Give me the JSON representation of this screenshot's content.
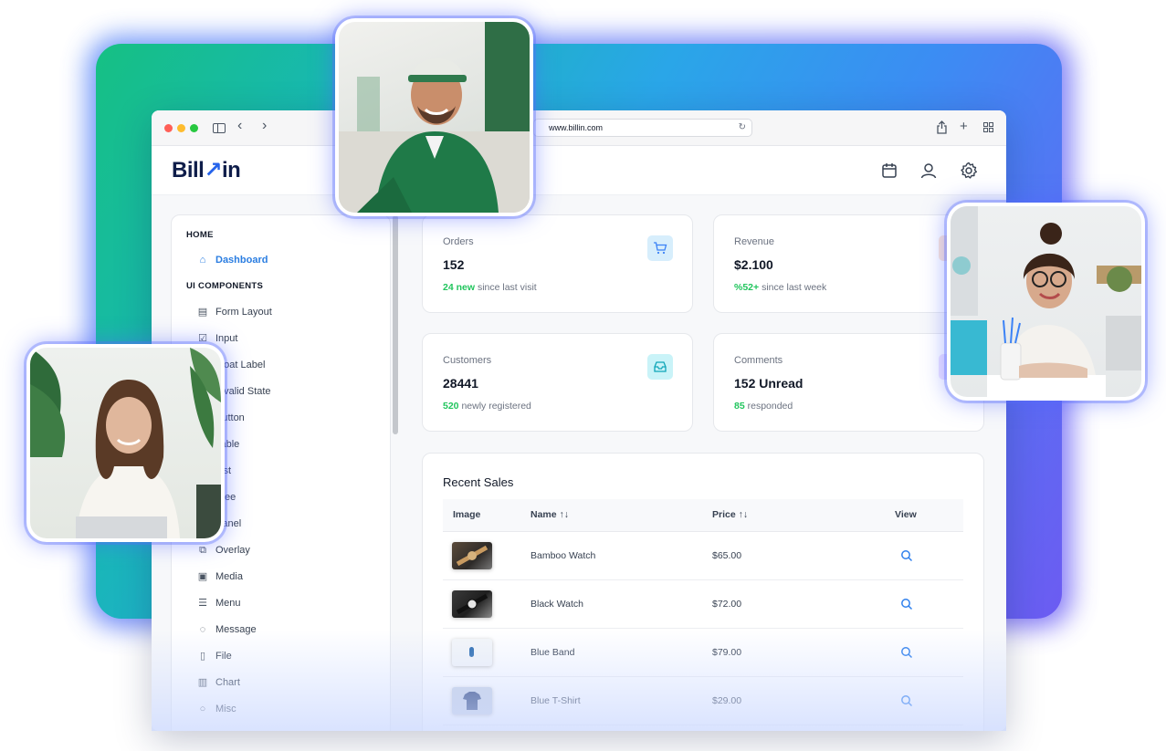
{
  "browser": {
    "url": "www.billin.com"
  },
  "app": {
    "logo_prefix": "Bill",
    "logo_accent": "↗",
    "logo_suffix": "in"
  },
  "icons": {
    "calendar": "calendar-icon",
    "user": "user-icon",
    "settings": "gear-icon"
  },
  "sidebar": {
    "home_title": "HOME",
    "dashboard": "Dashboard",
    "components_title": "UI COMPONENTS",
    "items": [
      "Form Layout",
      "Input",
      "Float Label",
      "Invalid State",
      "Button",
      "Table",
      "List",
      "Tree",
      "Panel",
      "Overlay",
      "Media",
      "Menu",
      "Message",
      "File",
      "Chart",
      "Misc"
    ]
  },
  "stats": {
    "orders": {
      "label": "Orders",
      "value": "152",
      "highlight": "24 new",
      "rest": " since last visit",
      "color": "#d7eefc"
    },
    "revenue": {
      "label": "Revenue",
      "value": "$2.100",
      "highlight": "%52+",
      "rest": " since last week",
      "color": "#fde5d4"
    },
    "customers": {
      "label": "Customers",
      "value": "28441",
      "highlight": "520",
      "rest": " newly registered",
      "color": "#c9f3f8"
    },
    "comments": {
      "label": "Comments",
      "value": "152 Unread",
      "highlight": "85",
      "rest": " responded",
      "color": "#ede3ff"
    }
  },
  "sales": {
    "title": "Recent Sales",
    "headers": {
      "image": "Image",
      "name": "Name",
      "price": "Price",
      "view": "View",
      "sort_glyph": "↑↓"
    },
    "rows": [
      {
        "name": "Bamboo Watch",
        "price": "$65.00"
      },
      {
        "name": "Black Watch",
        "price": "$72.00"
      },
      {
        "name": "Blue Band",
        "price": "$79.00"
      },
      {
        "name": "Blue T-Shirt",
        "price": "$29.00"
      }
    ]
  }
}
